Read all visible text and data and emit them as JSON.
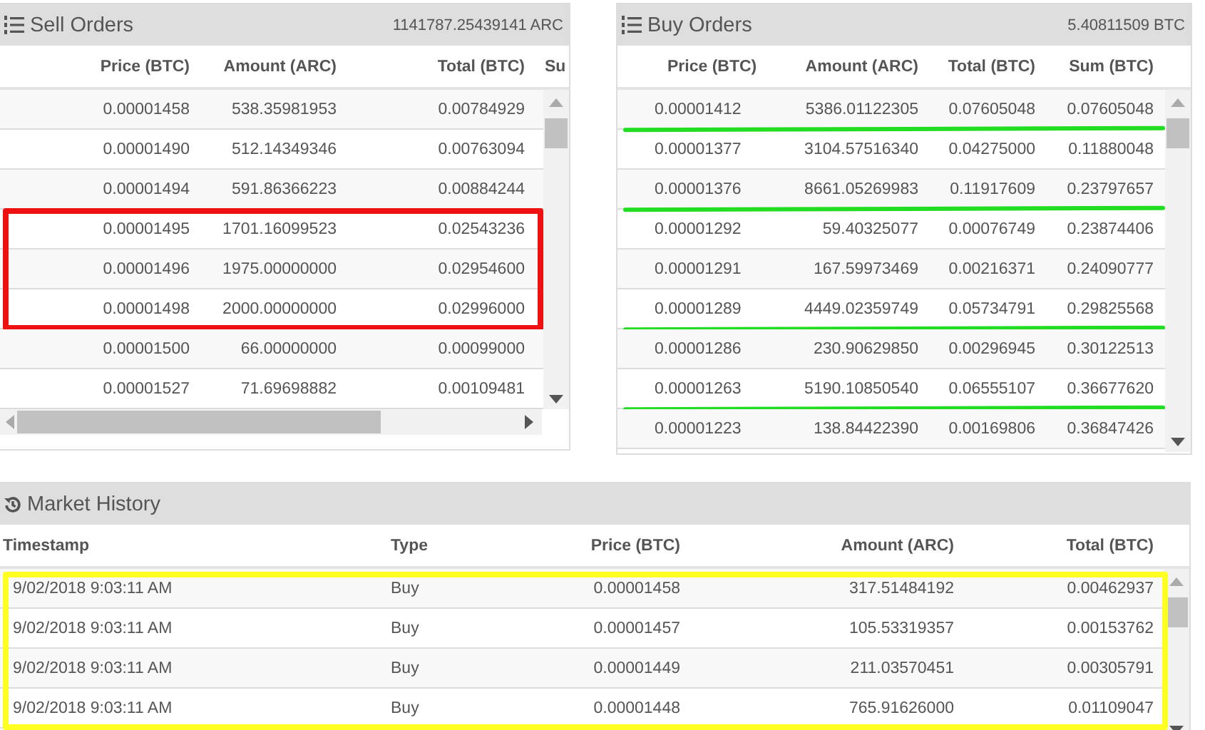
{
  "sell_orders": {
    "title": "Sell Orders",
    "total": "1141787.25439141 ARC",
    "columns": [
      "Price (BTC)",
      "Amount (ARC)",
      "Total (BTC)",
      "Su"
    ],
    "rows": [
      {
        "cells": [
          "0.00001458",
          "538.35981953",
          "0.00784929"
        ],
        "highlighted": false
      },
      {
        "cells": [
          "0.00001490",
          "512.14349346",
          "0.00763094"
        ],
        "highlighted": false
      },
      {
        "cells": [
          "0.00001494",
          "591.86366223",
          "0.00884244"
        ],
        "highlighted": false
      },
      {
        "cells": [
          "0.00001495",
          "1701.16099523",
          "0.02543236"
        ],
        "highlighted": true
      },
      {
        "cells": [
          "0.00001496",
          "1975.00000000",
          "0.02954600"
        ],
        "highlighted": true
      },
      {
        "cells": [
          "0.00001498",
          "2000.00000000",
          "0.02996000"
        ],
        "highlighted": true
      },
      {
        "cells": [
          "0.00001500",
          "66.00000000",
          "0.00099000"
        ],
        "highlighted": false
      },
      {
        "cells": [
          "0.00001527",
          "71.69698882",
          "0.00109481"
        ],
        "highlighted": false
      }
    ]
  },
  "buy_orders": {
    "title": "Buy Orders",
    "total": "5.40811509 BTC",
    "columns": [
      "Price (BTC)",
      "Amount (ARC)",
      "Total (BTC)",
      "Sum (BTC)"
    ],
    "rows": [
      {
        "cells": [
          "0.00001412",
          "5386.01122305",
          "0.07605048",
          "0.07605048"
        ],
        "underlined": true
      },
      {
        "cells": [
          "0.00001377",
          "3104.57516340",
          "0.04275000",
          "0.11880048"
        ],
        "underlined": false
      },
      {
        "cells": [
          "0.00001376",
          "8661.05269983",
          "0.11917609",
          "0.23797657"
        ],
        "underlined": true
      },
      {
        "cells": [
          "0.00001292",
          "59.40325077",
          "0.00076749",
          "0.23874406"
        ],
        "underlined": false
      },
      {
        "cells": [
          "0.00001291",
          "167.59973469",
          "0.00216371",
          "0.24090777"
        ],
        "underlined": false
      },
      {
        "cells": [
          "0.00001289",
          "4449.02359749",
          "0.05734791",
          "0.29825568"
        ],
        "underlined": true
      },
      {
        "cells": [
          "0.00001286",
          "230.90629850",
          "0.00296945",
          "0.30122513"
        ],
        "underlined": false
      },
      {
        "cells": [
          "0.00001263",
          "5190.10850540",
          "0.06555107",
          "0.36677620"
        ],
        "underlined": true
      },
      {
        "cells": [
          "0.00001223",
          "138.84422390",
          "0.00169806",
          "0.36847426"
        ],
        "underlined": false
      }
    ]
  },
  "market_history": {
    "title": "Market History",
    "columns": [
      "Timestamp",
      "Type",
      "Price (BTC)",
      "Amount (ARC)",
      "Total (BTC)"
    ],
    "rows": [
      {
        "cells": [
          "9/02/2018 9:03:11 AM",
          "Buy",
          "0.00001458",
          "317.51484192",
          "0.00462937"
        ],
        "highlighted": true
      },
      {
        "cells": [
          "9/02/2018 9:03:11 AM",
          "Buy",
          "0.00001457",
          "105.53319357",
          "0.00153762"
        ],
        "highlighted": true
      },
      {
        "cells": [
          "9/02/2018 9:03:11 AM",
          "Buy",
          "0.00001449",
          "211.03570451",
          "0.00305791"
        ],
        "highlighted": true
      },
      {
        "cells": [
          "9/02/2018 9:03:11 AM",
          "Buy",
          "0.00001448",
          "765.91626000",
          "0.01109047"
        ],
        "highlighted": true
      }
    ]
  }
}
